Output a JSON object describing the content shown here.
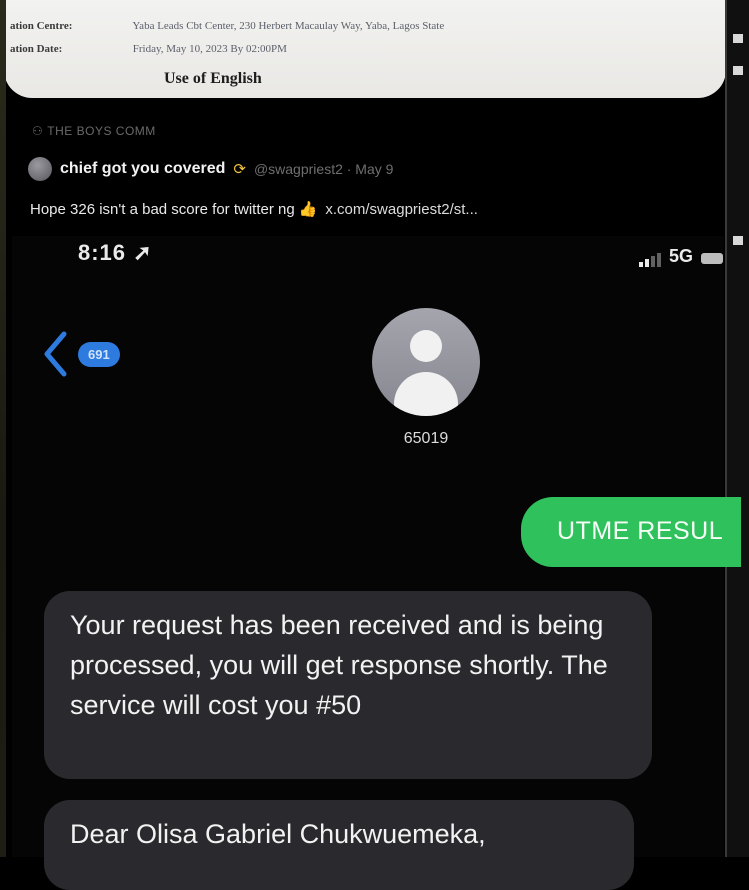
{
  "document": {
    "centre_label": "ation Centre:",
    "centre_value": "Yaba Leads Cbt Center, 230 Herbert Macaulay Way, Yaba, Lagos State",
    "date_label": "ation Date:",
    "date_value": "Friday, May 10, 2023 By 02:00PM",
    "subject": "Use of English"
  },
  "tweet": {
    "context": "THE BOYS COMM",
    "author_name": "chief got you covered",
    "author_handle": "@swagpriest2 · May 9",
    "body_text": "Hope 326 isn't a bad score for twitter ng",
    "link": "x.com/swagpriest2/st..."
  },
  "status_bar": {
    "time": "8:16",
    "network": "5G"
  },
  "conversation": {
    "unread_count": "691",
    "contact_name": "65019"
  },
  "messages": {
    "outgoing_text": "UTME RESUL",
    "incoming_1": "Your request has been received and is being processed, you will get response shortly. The service will cost you #50",
    "incoming_2": "Dear Olisa Gabriel Chukwuemeka,"
  },
  "colors": {
    "accent_blue": "#2e7be0",
    "sms_green": "#2fc15b",
    "bubble_gray": "#2a2a2e"
  }
}
